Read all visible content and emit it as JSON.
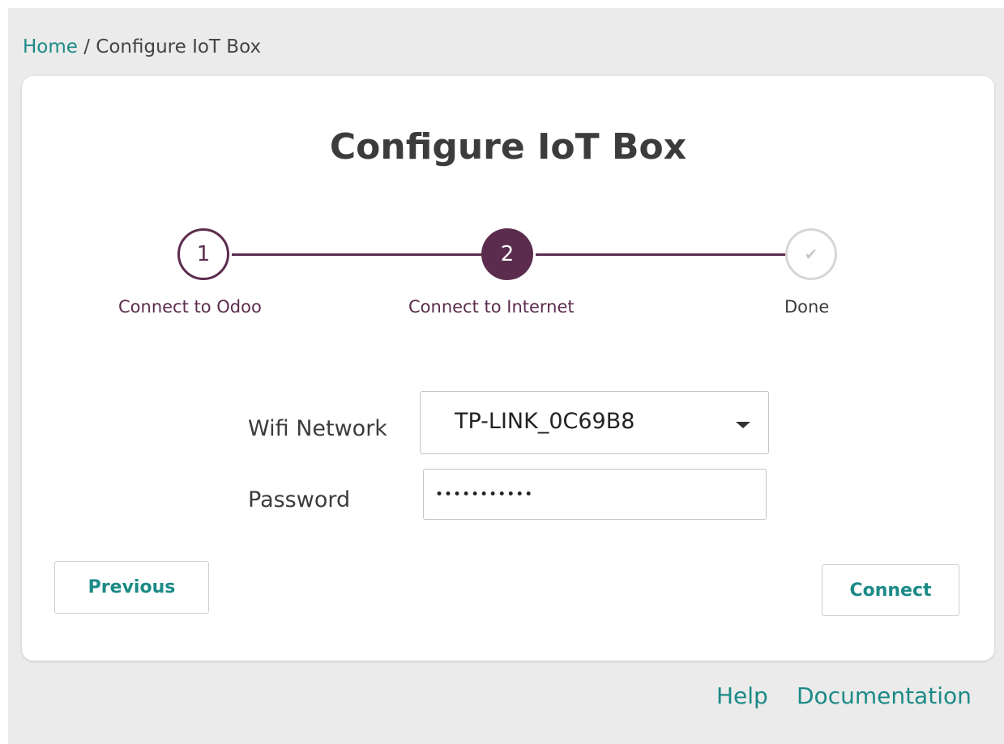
{
  "breadcrumb": {
    "home": "Home",
    "separator": "/",
    "current": "Configure IoT Box"
  },
  "title": "Configure IoT Box",
  "steps": [
    {
      "number": "1",
      "label": "Connect to Odoo",
      "state": "completed"
    },
    {
      "number": "2",
      "label": "Connect to Internet",
      "state": "active"
    },
    {
      "number": "✔",
      "label": "Done",
      "state": "pending"
    }
  ],
  "form": {
    "wifi_label": "Wifi Network",
    "wifi_value": "TP-LINK_0C69B8",
    "password_label": "Password",
    "password_value": "•••••••••••"
  },
  "buttons": {
    "previous": "Previous",
    "connect": "Connect"
  },
  "footer": {
    "help": "Help",
    "documentation": "Documentation"
  },
  "colors": {
    "accent": "#1c8a87",
    "step_primary": "#5b2c4d",
    "step_pending": "#d6d6d6",
    "background": "#ebebeb"
  },
  "icons": {
    "dropdown": "caret-down-icon",
    "done": "checkmark-icon"
  }
}
